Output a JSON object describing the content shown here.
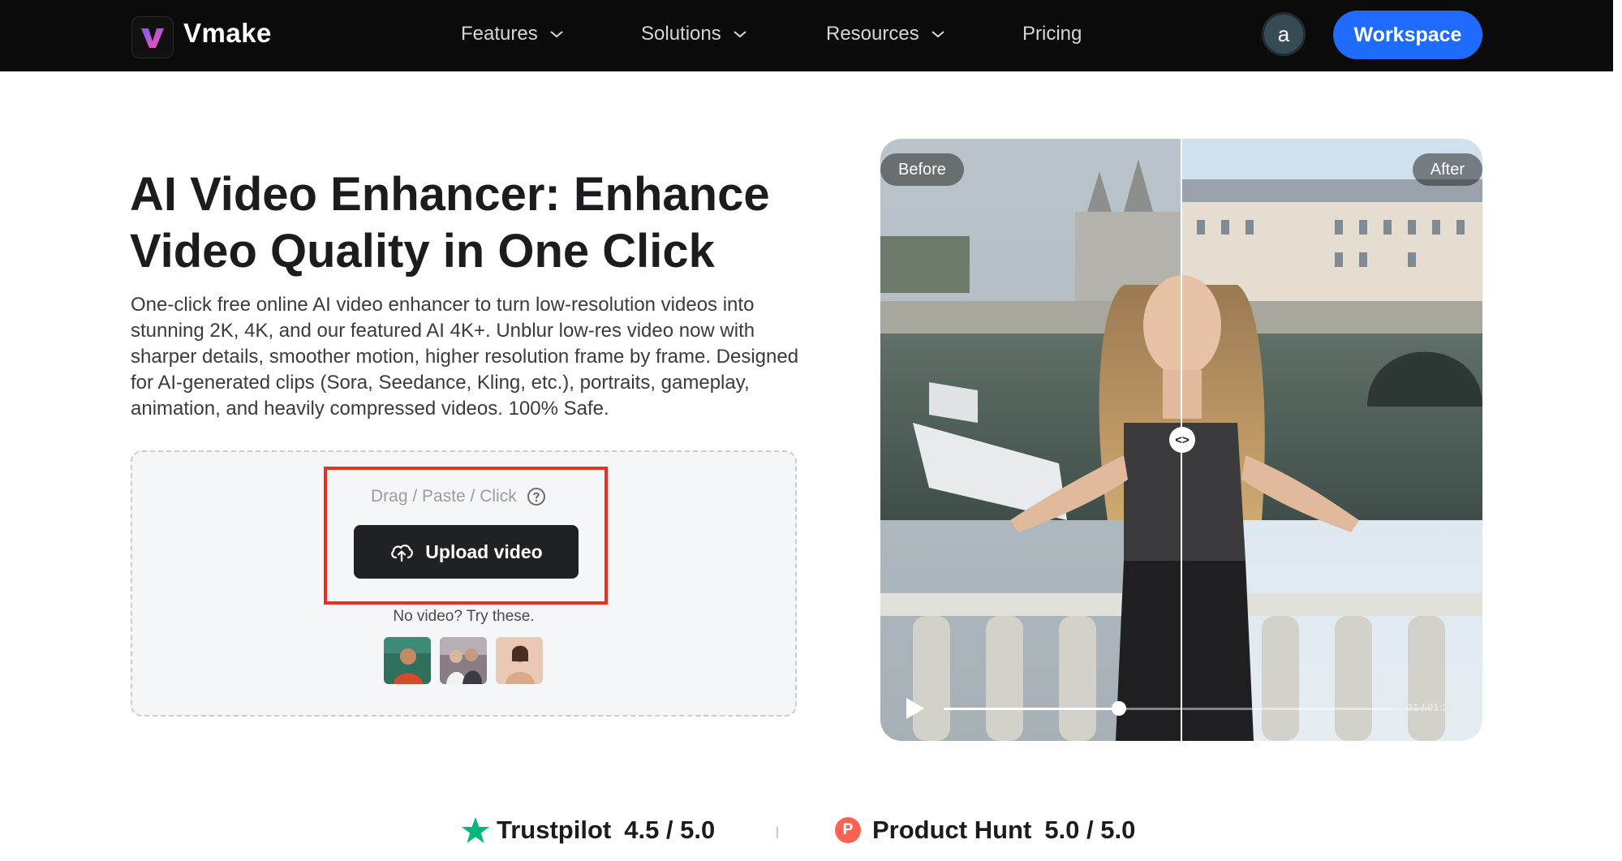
{
  "header": {
    "brand": "Vmake",
    "nav": [
      {
        "label": "Features",
        "has_dropdown": true
      },
      {
        "label": "Solutions",
        "has_dropdown": true
      },
      {
        "label": "Resources",
        "has_dropdown": true
      },
      {
        "label": "Pricing",
        "has_dropdown": false
      }
    ],
    "avatar_letter": "a",
    "workspace_label": "Workspace"
  },
  "hero": {
    "title": "AI Video Enhancer: Enhance Video Quality in One Click",
    "description": "One-click free online AI video enhancer to turn low-resolution videos into stunning 2K, 4K, and our featured AI 4K+. Unblur low-res video now with sharper details, smoother motion, higher resolution frame by frame. Designed for AI-generated clips (Sora, Seedance, Kling, etc.), portraits, gameplay, animation, and heavily compressed videos. 100% Safe."
  },
  "upload": {
    "hint": "Drag / Paste / Click",
    "button_label": "Upload video",
    "no_video_text": "No video? Try these.",
    "samples": [
      "sample-video-1",
      "sample-video-2",
      "sample-video-3"
    ]
  },
  "preview": {
    "before_label": "Before",
    "after_label": "After",
    "time": "00:21 / 01:26",
    "progress": 0.36
  },
  "ratings": [
    {
      "name": "Trustpilot",
      "score": "4.5 / 5.0",
      "icon": "star-icon"
    },
    {
      "name": "Product Hunt",
      "score": "5.0 / 5.0",
      "icon": "product-hunt-icon"
    }
  ],
  "colors": {
    "accent": "#1f6bff",
    "highlight": "#e8321f",
    "trustpilot": "#00b67a",
    "product_hunt": "#ff6154"
  }
}
